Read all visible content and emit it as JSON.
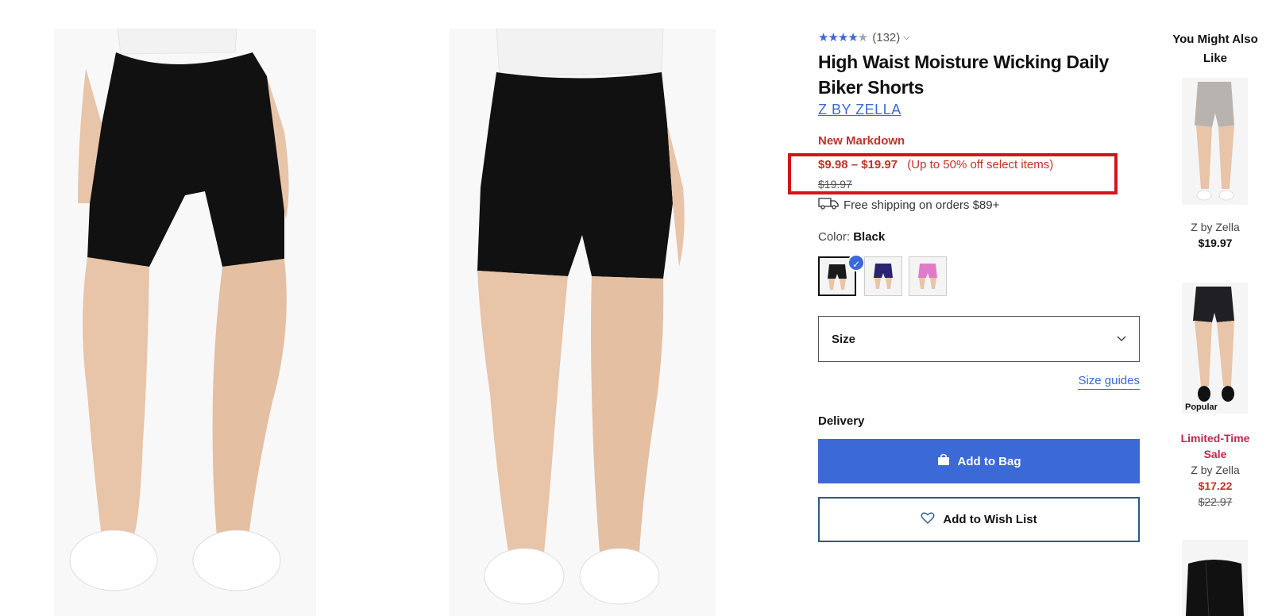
{
  "product": {
    "rating_count": "(132)",
    "title": "High Waist Moisture Wicking Daily Biker Shorts",
    "brand": "Z BY ZELLA",
    "markdown_label": "New Markdown",
    "price_range": "$9.98 – $19.97",
    "price_note": "(Up to 50% off select items)",
    "original_price": "$19.97",
    "shipping": "Free shipping on orders $89+",
    "color_label": "Color:",
    "color_value": "Black",
    "rating_stars": 4.5
  },
  "swatches": [
    {
      "name": "Black",
      "color": "#1a1a1a",
      "selected": true
    },
    {
      "name": "Navy",
      "color": "#2b2470",
      "selected": false
    },
    {
      "name": "Pink",
      "color": "#e07cc7",
      "selected": false
    }
  ],
  "size": {
    "label": "Size",
    "guides_label": "Size guides"
  },
  "delivery": {
    "label": "Delivery"
  },
  "buttons": {
    "add_to_bag": "Add to Bag",
    "add_to_wish": "Add to Wish List"
  },
  "recommendations": {
    "title": "You Might Also Like",
    "items": [
      {
        "brand": "Z by Zella",
        "price": "$19.97"
      },
      {
        "badge": "Popular",
        "sale_label": "Limited-Time Sale",
        "brand": "Z by Zella",
        "price": "$17.22",
        "original_price": "$22.97"
      }
    ]
  },
  "colors": {
    "accent": "#3b69d6",
    "sale": "#c0332a",
    "highlight_border": "#d4141b"
  }
}
